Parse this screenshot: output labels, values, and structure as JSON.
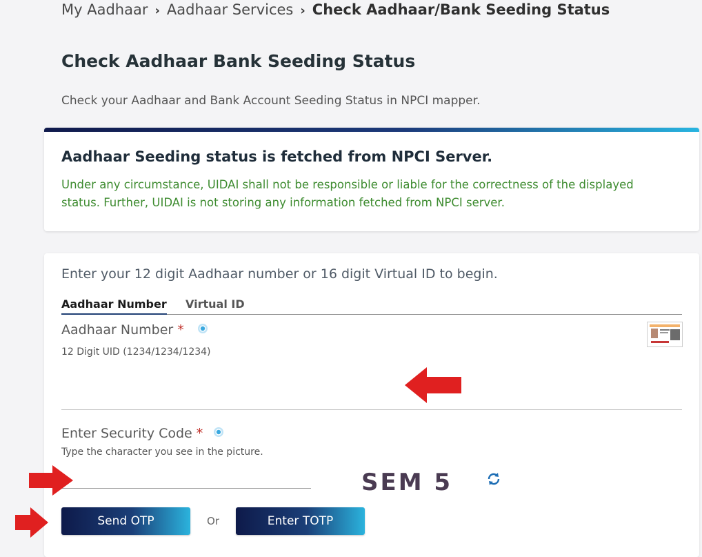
{
  "breadcrumb": {
    "items": [
      "My Aadhaar",
      "Aadhaar Services",
      "Check Aadhaar/Bank Seeding Status"
    ],
    "separator": "›"
  },
  "page": {
    "title": "Check Aadhaar Bank Seeding Status",
    "subtitle": "Check your Aadhaar and Bank Account Seeding Status in NPCI mapper."
  },
  "notice": {
    "title": "Aadhaar Seeding status is fetched from NPCI Server.",
    "text": "Under any circumstance, UIDAI shall not be responsible or liable for the correctness of the displayed status. Further, UIDAI is not storing any information fetched from NPCI server."
  },
  "form": {
    "intro": "Enter your 12 digit Aadhaar number or 16 digit Virtual ID to begin.",
    "tabs": [
      {
        "label": "Aadhaar Number",
        "active": true
      },
      {
        "label": "Virtual ID",
        "active": false
      }
    ],
    "aadhaar_field": {
      "label": "Aadhaar Number",
      "required_mark": "*",
      "hint": "12 Digit UID (1234/1234/1234)",
      "value": ""
    },
    "captcha_field": {
      "label": "Enter Security Code",
      "required_mark": "*",
      "hint": "Type the character you see in the picture.",
      "value": "",
      "captcha_text": "SEM 5"
    },
    "buttons": {
      "send_otp": "Send OTP",
      "or": "Or",
      "enter_totp": "Enter TOTP"
    }
  },
  "colors": {
    "notice_text": "#3d8b2f",
    "required": "#c0302a",
    "annotation_arrow": "#e02020",
    "button_gradient_start": "#0e1a4a",
    "button_gradient_end": "#2bb3dd"
  },
  "icons": [
    "info-icon",
    "refresh-icon",
    "aadhaar-card-thumbnail",
    "red-arrow-annotation"
  ]
}
